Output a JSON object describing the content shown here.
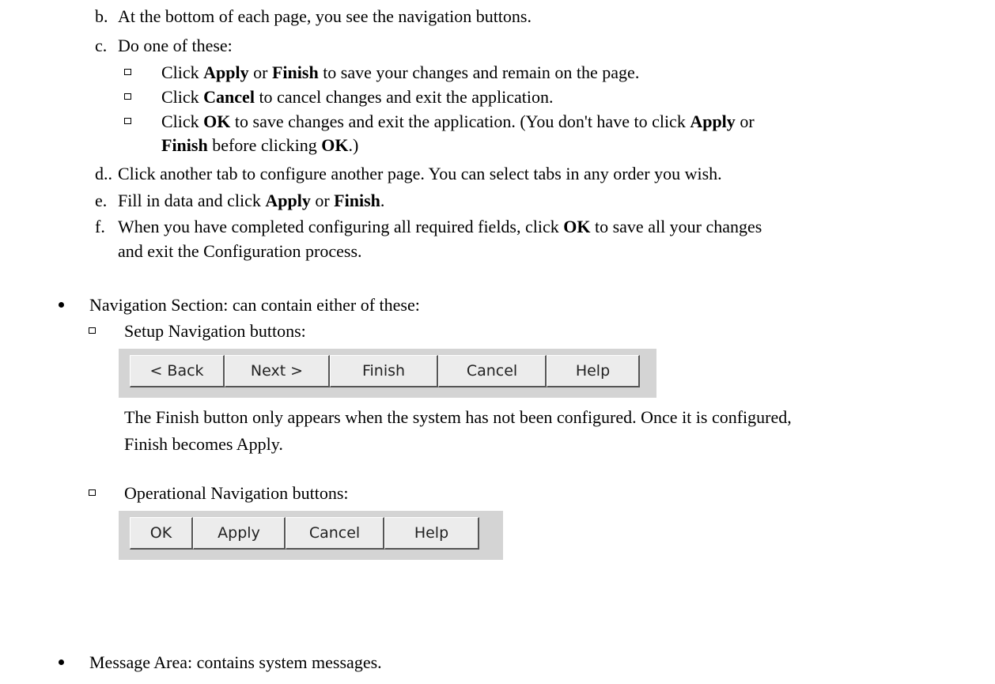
{
  "steps": {
    "b": {
      "label": "b.",
      "text": "At the bottom of each page, you see the navigation buttons."
    },
    "c": {
      "label": "c.",
      "text": "Do one of these:"
    },
    "c_sub1": {
      "pre": "Click ",
      "bold1": "Apply",
      "mid1": " or ",
      "bold2": "Finish",
      "post": " to save your changes and remain on the page."
    },
    "c_sub2": {
      "pre": "Click ",
      "bold1": "Cancel",
      "post": " to cancel changes and exit the application."
    },
    "c_sub3": {
      "pre": "Click ",
      "bold1": "OK",
      "mid1": " to save changes and exit the application. (You don't have to click ",
      "bold2": "Apply",
      "post": " or"
    },
    "c_sub3_cont": {
      "bold1": "Finish",
      "mid1": " before clicking ",
      "bold2": "OK",
      "post": ".)"
    },
    "d": {
      "label": "d..",
      "text": "Click another tab to configure another page. You can select tabs in any order you wish."
    },
    "e": {
      "label": "e.",
      "pre": "Fill in data and click ",
      "bold1": "Apply",
      "mid1": " or ",
      "bold2": "Finish",
      "post": "."
    },
    "f": {
      "label": "f.",
      "pre": "When you have completed configuring all required fields, click ",
      "bold1": "OK",
      "post": " to save all your changes"
    },
    "f_cont": {
      "text": "and exit the Configuration process."
    }
  },
  "navigation": {
    "intro": "Navigation Section: can contain either of these:",
    "setup_title": "Setup Navigation buttons:",
    "setup_buttons": [
      "< Back",
      "Next >",
      "Finish",
      "Cancel",
      "Help"
    ],
    "setup_note_1": "The Finish button only appears when the system has not been configured. Once it is configured,",
    "setup_note_2": "Finish becomes Apply.",
    "operational_title": "Operational Navigation buttons:",
    "operational_buttons": [
      "OK",
      "Apply",
      "Cancel",
      "Help"
    ]
  },
  "message_area": {
    "text": "Message Area: contains system messages."
  }
}
